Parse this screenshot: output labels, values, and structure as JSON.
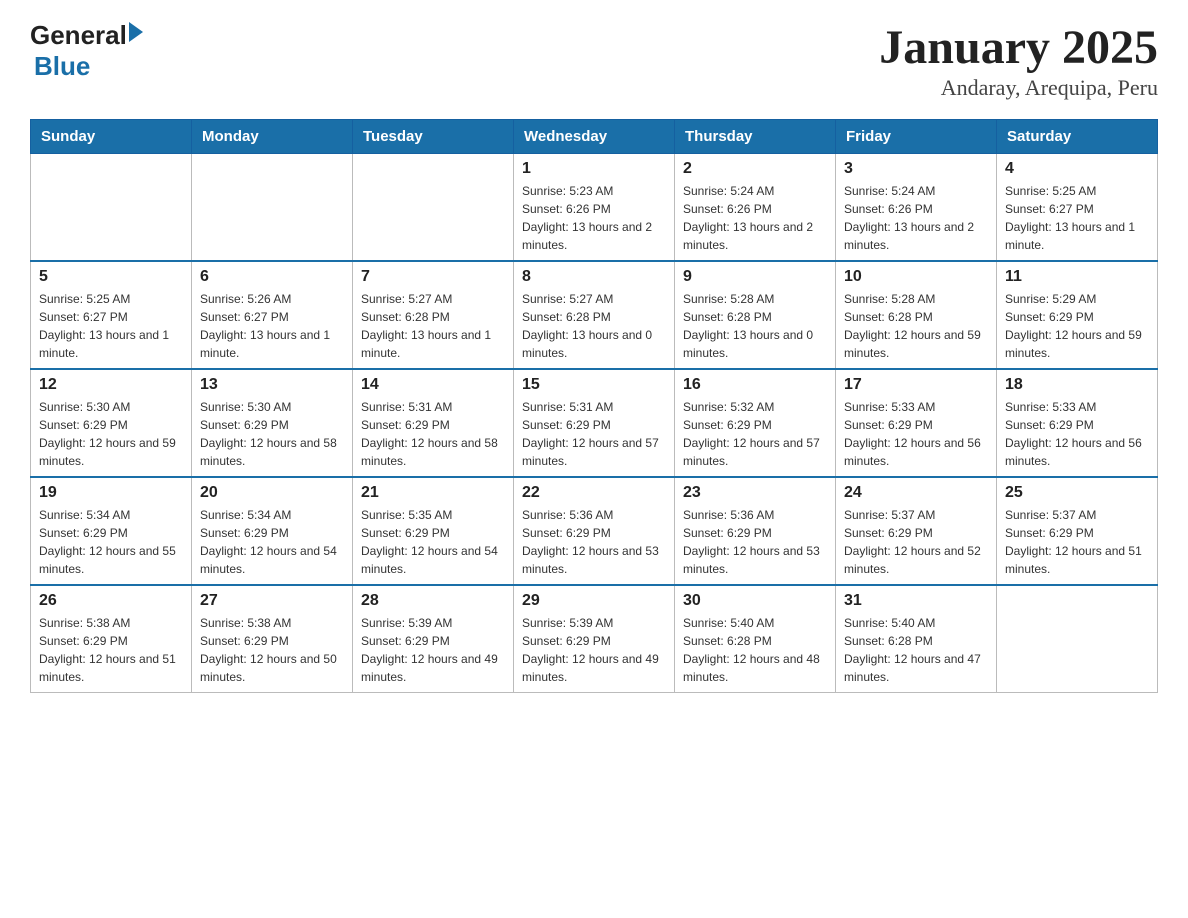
{
  "logo": {
    "text_general": "General",
    "text_blue": "Blue"
  },
  "title": "January 2025",
  "subtitle": "Andaray, Arequipa, Peru",
  "days_of_week": [
    "Sunday",
    "Monday",
    "Tuesday",
    "Wednesday",
    "Thursday",
    "Friday",
    "Saturday"
  ],
  "weeks": [
    [
      {
        "day": "",
        "info": ""
      },
      {
        "day": "",
        "info": ""
      },
      {
        "day": "",
        "info": ""
      },
      {
        "day": "1",
        "info": "Sunrise: 5:23 AM\nSunset: 6:26 PM\nDaylight: 13 hours and 2 minutes."
      },
      {
        "day": "2",
        "info": "Sunrise: 5:24 AM\nSunset: 6:26 PM\nDaylight: 13 hours and 2 minutes."
      },
      {
        "day": "3",
        "info": "Sunrise: 5:24 AM\nSunset: 6:26 PM\nDaylight: 13 hours and 2 minutes."
      },
      {
        "day": "4",
        "info": "Sunrise: 5:25 AM\nSunset: 6:27 PM\nDaylight: 13 hours and 1 minute."
      }
    ],
    [
      {
        "day": "5",
        "info": "Sunrise: 5:25 AM\nSunset: 6:27 PM\nDaylight: 13 hours and 1 minute."
      },
      {
        "day": "6",
        "info": "Sunrise: 5:26 AM\nSunset: 6:27 PM\nDaylight: 13 hours and 1 minute."
      },
      {
        "day": "7",
        "info": "Sunrise: 5:27 AM\nSunset: 6:28 PM\nDaylight: 13 hours and 1 minute."
      },
      {
        "day": "8",
        "info": "Sunrise: 5:27 AM\nSunset: 6:28 PM\nDaylight: 13 hours and 0 minutes."
      },
      {
        "day": "9",
        "info": "Sunrise: 5:28 AM\nSunset: 6:28 PM\nDaylight: 13 hours and 0 minutes."
      },
      {
        "day": "10",
        "info": "Sunrise: 5:28 AM\nSunset: 6:28 PM\nDaylight: 12 hours and 59 minutes."
      },
      {
        "day": "11",
        "info": "Sunrise: 5:29 AM\nSunset: 6:29 PM\nDaylight: 12 hours and 59 minutes."
      }
    ],
    [
      {
        "day": "12",
        "info": "Sunrise: 5:30 AM\nSunset: 6:29 PM\nDaylight: 12 hours and 59 minutes."
      },
      {
        "day": "13",
        "info": "Sunrise: 5:30 AM\nSunset: 6:29 PM\nDaylight: 12 hours and 58 minutes."
      },
      {
        "day": "14",
        "info": "Sunrise: 5:31 AM\nSunset: 6:29 PM\nDaylight: 12 hours and 58 minutes."
      },
      {
        "day": "15",
        "info": "Sunrise: 5:31 AM\nSunset: 6:29 PM\nDaylight: 12 hours and 57 minutes."
      },
      {
        "day": "16",
        "info": "Sunrise: 5:32 AM\nSunset: 6:29 PM\nDaylight: 12 hours and 57 minutes."
      },
      {
        "day": "17",
        "info": "Sunrise: 5:33 AM\nSunset: 6:29 PM\nDaylight: 12 hours and 56 minutes."
      },
      {
        "day": "18",
        "info": "Sunrise: 5:33 AM\nSunset: 6:29 PM\nDaylight: 12 hours and 56 minutes."
      }
    ],
    [
      {
        "day": "19",
        "info": "Sunrise: 5:34 AM\nSunset: 6:29 PM\nDaylight: 12 hours and 55 minutes."
      },
      {
        "day": "20",
        "info": "Sunrise: 5:34 AM\nSunset: 6:29 PM\nDaylight: 12 hours and 54 minutes."
      },
      {
        "day": "21",
        "info": "Sunrise: 5:35 AM\nSunset: 6:29 PM\nDaylight: 12 hours and 54 minutes."
      },
      {
        "day": "22",
        "info": "Sunrise: 5:36 AM\nSunset: 6:29 PM\nDaylight: 12 hours and 53 minutes."
      },
      {
        "day": "23",
        "info": "Sunrise: 5:36 AM\nSunset: 6:29 PM\nDaylight: 12 hours and 53 minutes."
      },
      {
        "day": "24",
        "info": "Sunrise: 5:37 AM\nSunset: 6:29 PM\nDaylight: 12 hours and 52 minutes."
      },
      {
        "day": "25",
        "info": "Sunrise: 5:37 AM\nSunset: 6:29 PM\nDaylight: 12 hours and 51 minutes."
      }
    ],
    [
      {
        "day": "26",
        "info": "Sunrise: 5:38 AM\nSunset: 6:29 PM\nDaylight: 12 hours and 51 minutes."
      },
      {
        "day": "27",
        "info": "Sunrise: 5:38 AM\nSunset: 6:29 PM\nDaylight: 12 hours and 50 minutes."
      },
      {
        "day": "28",
        "info": "Sunrise: 5:39 AM\nSunset: 6:29 PM\nDaylight: 12 hours and 49 minutes."
      },
      {
        "day": "29",
        "info": "Sunrise: 5:39 AM\nSunset: 6:29 PM\nDaylight: 12 hours and 49 minutes."
      },
      {
        "day": "30",
        "info": "Sunrise: 5:40 AM\nSunset: 6:28 PM\nDaylight: 12 hours and 48 minutes."
      },
      {
        "day": "31",
        "info": "Sunrise: 5:40 AM\nSunset: 6:28 PM\nDaylight: 12 hours and 47 minutes."
      },
      {
        "day": "",
        "info": ""
      }
    ]
  ]
}
